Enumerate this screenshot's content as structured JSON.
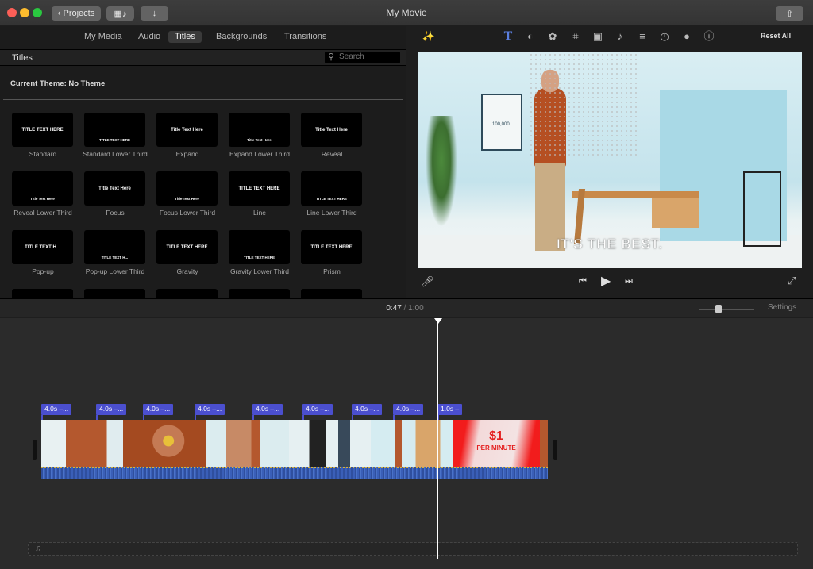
{
  "window": {
    "title": "My Movie",
    "projects_label": "Projects"
  },
  "browser": {
    "tabs": [
      {
        "label": "My Media"
      },
      {
        "label": "Audio"
      },
      {
        "label": "Titles",
        "selected": true
      },
      {
        "label": "Backgrounds"
      },
      {
        "label": "Transitions"
      }
    ],
    "section_title": "Titles",
    "search_placeholder": "Search",
    "theme_label": "Current Theme: No Theme",
    "titles": [
      {
        "name": "Standard",
        "preview": "TITLE TEXT HERE"
      },
      {
        "name": "Standard Lower Third",
        "preview": "TITLE TEXT HERE"
      },
      {
        "name": "Expand",
        "preview": "Title Text Here"
      },
      {
        "name": "Expand Lower Third",
        "preview": "Title Text Here"
      },
      {
        "name": "Reveal",
        "preview": "Title Text Here"
      },
      {
        "name": "Reveal Lower Third",
        "preview": "Title Text Here"
      },
      {
        "name": "Focus",
        "preview": "Title Text Here"
      },
      {
        "name": "Focus Lower Third",
        "preview": "Title Text Here"
      },
      {
        "name": "Line",
        "preview": "TITLE TEXT HERE"
      },
      {
        "name": "Line Lower Third",
        "preview": "TITLE TEXT HERE"
      },
      {
        "name": "Pop-up",
        "preview": "TITLE TEXT H..."
      },
      {
        "name": "Pop-up Lower Third",
        "preview": "TITLE TEXT H..."
      },
      {
        "name": "Gravity",
        "preview": "TITLE TEXT HERE"
      },
      {
        "name": "Gravity Lower Third",
        "preview": "TITLE TEXT HERE"
      },
      {
        "name": "Prism",
        "preview": "TITLE TEXT HERE"
      }
    ]
  },
  "inspector": {
    "tools": [
      "magic-wand-icon",
      "title-text-icon",
      "color-balance-icon",
      "color-palette-icon",
      "crop-icon",
      "stabilization-icon",
      "volume-icon",
      "equalizer-icon",
      "speed-icon",
      "filter-icon",
      "info-icon"
    ],
    "reset_label": "Reset All",
    "accent": "#5b7fe0"
  },
  "viewer": {
    "caption": "IT'S THE BEST.",
    "poster_number": "100,000"
  },
  "timeline": {
    "current_time": "0:47",
    "separator": "/",
    "total_time": "1:00",
    "settings_label": "Settings",
    "zoom_level": 0.35,
    "title_markers": [
      "4.0s –...",
      "4.0s –...",
      "4.0s –...",
      "4.0s –...",
      "4.0s –...",
      "4.0s –...",
      "4.0s –...",
      "4.0s –...",
      "1.0s –"
    ],
    "clip_overlay_price": "$1",
    "clip_overlay_text": "PER MINUTE",
    "marker_color": "#4b4fcf",
    "audio_color": "#3a5fb8"
  }
}
